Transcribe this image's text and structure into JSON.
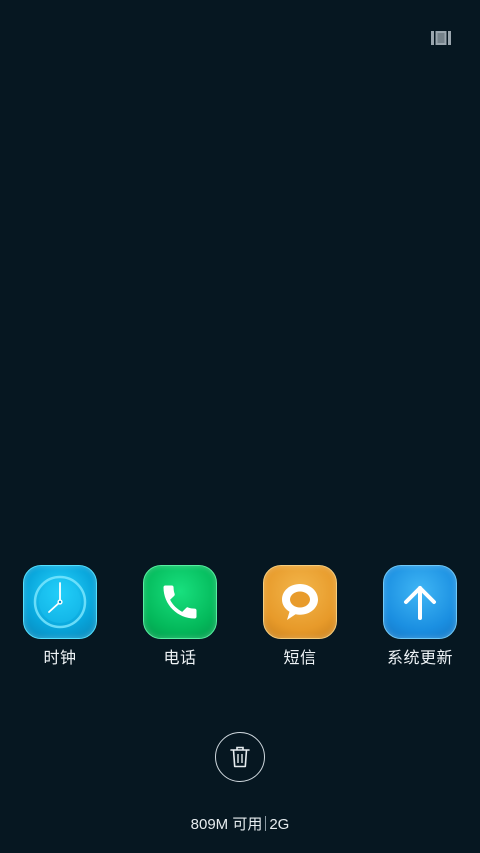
{
  "top_action": {
    "icon": "card-view-icon"
  },
  "apps": [
    {
      "label": "时钟",
      "icon": "clock-icon",
      "color": "#0aa6dc"
    },
    {
      "label": "电话",
      "icon": "phone-icon",
      "color": "#05b95b"
    },
    {
      "label": "短信",
      "icon": "message-icon",
      "color": "#e89b2b"
    },
    {
      "label": "系统更新",
      "icon": "arrow-up-icon",
      "color": "#1c8fe1"
    }
  ],
  "clear_button": {
    "icon": "trash-icon"
  },
  "memory": {
    "available": "809M 可用",
    "total": "2G"
  },
  "colors": {
    "background": "#061721",
    "text": "#eef3f6"
  }
}
